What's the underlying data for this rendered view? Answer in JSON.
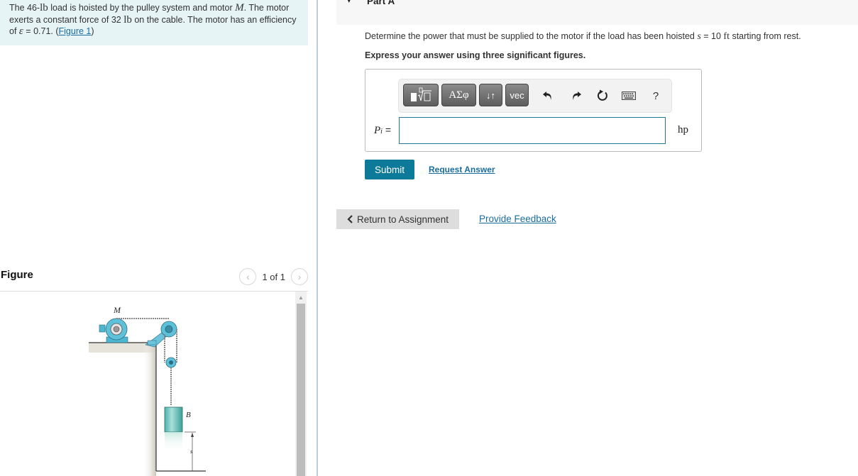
{
  "problem": {
    "text_1": "The 46-",
    "unit_lb": "lb",
    "text_2": " load is hoisted by the pulley system and motor ",
    "motor_symbol": "M",
    "text_3": ". The motor exerts a constant force of 32 ",
    "text_4": " on the cable. The motor has an efficiency of ",
    "epsilon_symbol": "ε",
    "text_5": " = 0.71. (",
    "figure_link": "Figure 1",
    "text_6": ")"
  },
  "figure": {
    "title": "Figure",
    "pager_text": "1 of 1",
    "prev_icon": "‹",
    "next_icon": "›",
    "labels": {
      "motor": "M",
      "load": "B",
      "distance": "s"
    }
  },
  "part": {
    "caret": "▾",
    "title": "Part A",
    "question_1": "Determine the power that must be supplied to the motor if the load has been hoisted ",
    "question_var": "s",
    "question_2": " = 10 ",
    "question_unit": "ft",
    "question_3": " starting from rest.",
    "instruction": "Express your answer using three significant figures."
  },
  "toolbar": {
    "templates_label": "templates",
    "greek_label": "ΑΣφ",
    "sort_label": "↓↑",
    "vec_label": "vec",
    "help_label": "?"
  },
  "answer": {
    "var": "P",
    "sub": "i",
    "equals": " =",
    "value": "",
    "unit": "hp"
  },
  "actions": {
    "submit": "Submit",
    "request_answer": "Request Answer",
    "return_label": "Return to Assignment",
    "feedback": "Provide Feedback"
  }
}
